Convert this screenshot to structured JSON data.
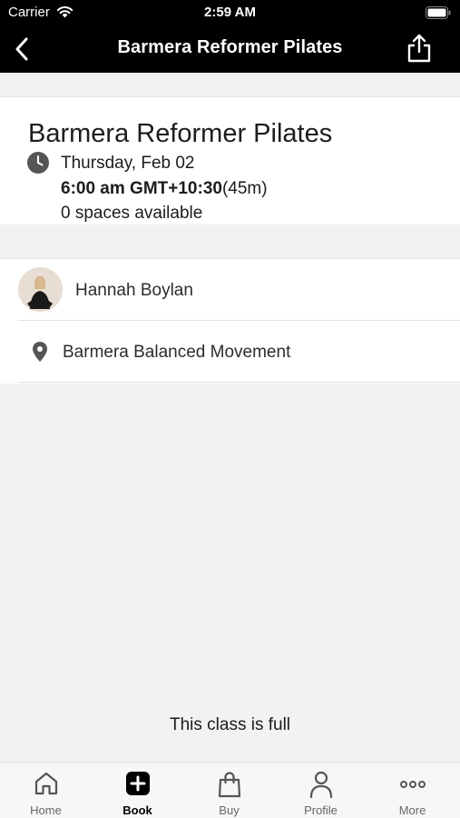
{
  "status_bar": {
    "carrier": "Carrier",
    "time": "2:59 AM"
  },
  "nav": {
    "title": "Barmera Reformer Pilates",
    "back_icon": "chevron-left-icon",
    "share_icon": "share-icon"
  },
  "class": {
    "title": "Barmera Reformer Pilates",
    "date": "Thursday, Feb 02",
    "time": "6:00 am GMT+10:30",
    "duration": "(45m)",
    "spaces": "0 spaces available"
  },
  "instructor": {
    "name": "Hannah Boylan"
  },
  "location": {
    "name": "Barmera Balanced Movement"
  },
  "message": "This class is full",
  "tabs": [
    {
      "label": "Home",
      "icon": "home-icon"
    },
    {
      "label": "Book",
      "icon": "plus-square-icon",
      "active": true
    },
    {
      "label": "Buy",
      "icon": "shopping-bag-icon"
    },
    {
      "label": "Profile",
      "icon": "person-icon"
    },
    {
      "label": "More",
      "icon": "ellipsis-icon"
    }
  ]
}
